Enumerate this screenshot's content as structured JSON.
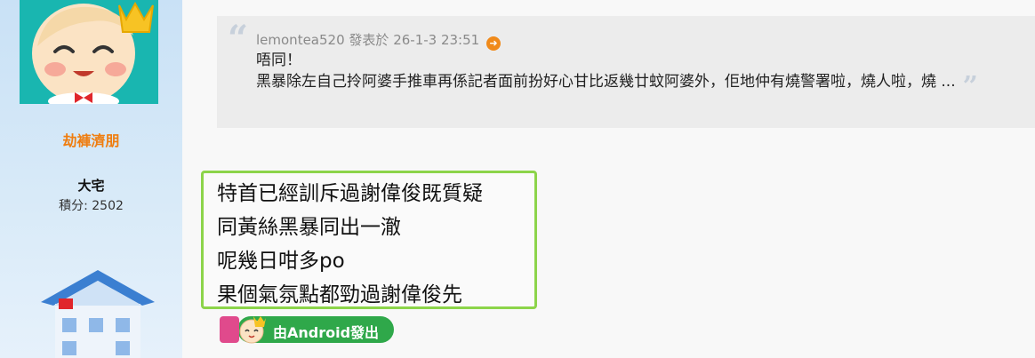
{
  "poster": {
    "name": "劫褲濟朋",
    "rank": "大宅",
    "points": "積分: 2502"
  },
  "quote": {
    "author": "lemontea520",
    "posted_label": "發表於",
    "datetime": "26-1-3 23:51",
    "line1": "唔同！",
    "line2": "黑暴除左自己拎阿婆手推車再係記者面前扮好心甘比返幾廿蚊阿婆外，佢地仲有燒警署啦，燒人啦，燒 ..."
  },
  "reply": {
    "lines": [
      "特首已經訓斥過謝偉俊既質疑",
      "同黃絲黑暴同出一澈",
      "呢幾日咁多po",
      "果個氣氛點都勁過謝偉俊先"
    ]
  },
  "device_badge": {
    "label": "由Android發出"
  },
  "colors": {
    "accent_orange": "#ef7d0f",
    "reply_border": "#8cd44a",
    "badge_green": "#2fa84a"
  }
}
